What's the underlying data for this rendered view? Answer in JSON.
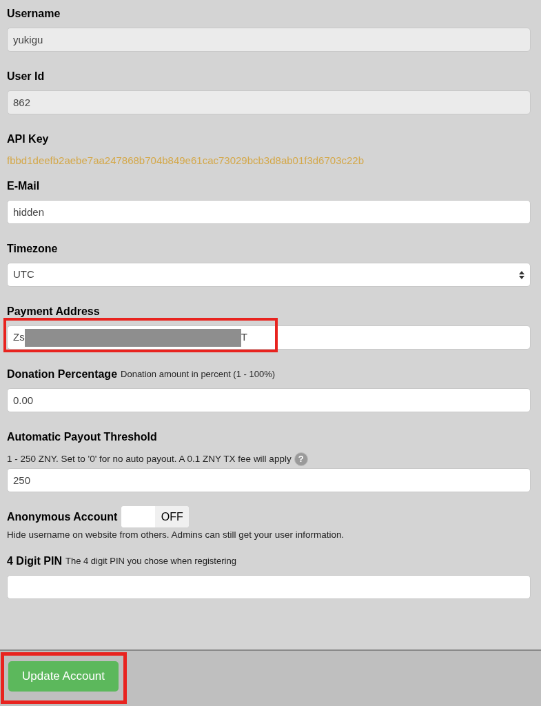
{
  "fields": [
    {
      "kind": "input",
      "label": "Username",
      "value": "yukigu",
      "readonly": true
    },
    {
      "kind": "input",
      "label": "User Id",
      "value": "862",
      "readonly": true
    },
    {
      "kind": "key",
      "label": "API Key",
      "value": "fbbd1deefb2aebe7aa247868b704b849e61cac73029bcb3d8ab01f3d6703c22b"
    },
    {
      "kind": "input",
      "label": "E-Mail",
      "value": "hidden",
      "readonly": false
    },
    {
      "kind": "select",
      "label": "Timezone",
      "value": "UTC"
    },
    {
      "kind": "redacted",
      "label": "Payment Address",
      "value_start": "Zs",
      "value_end": "T",
      "highlighted": true
    },
    {
      "kind": "input",
      "label": "Donation Percentage",
      "note": "Donation amount in percent (1 - 100%)",
      "value": "0.00",
      "readonly": false
    },
    {
      "kind": "input",
      "label": "Automatic Payout Threshold",
      "hint": "1 - 250 ZNY. Set to '0' for no auto payout. A 0.1 ZNY TX fee will apply",
      "help_icon": "?",
      "value": "250",
      "readonly": false
    },
    {
      "kind": "toggle",
      "label": "Anonymous Account",
      "toggle_text": "OFF",
      "on": false,
      "hint": "Hide username on website from others. Admins can still get your user information."
    },
    {
      "kind": "input",
      "label": "4 Digit PIN",
      "note": "The 4 digit PIN you chose when registering",
      "readonly": false
    }
  ],
  "submit": {
    "label": "Update Account",
    "highlighted": true
  }
}
